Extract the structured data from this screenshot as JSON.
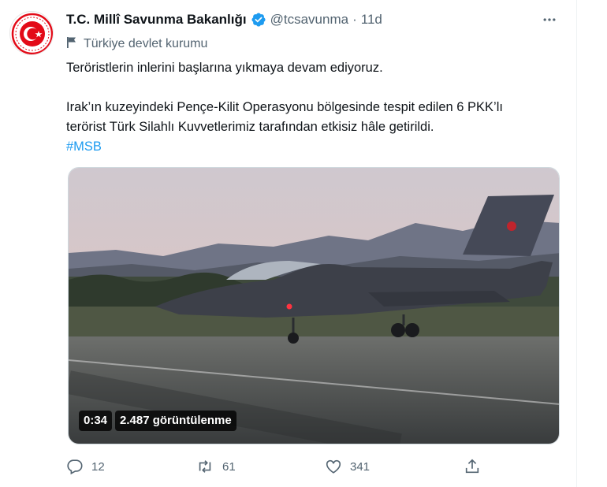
{
  "tweet": {
    "author": {
      "name": "T.C. Millî Savunma Bakanlığı",
      "handle": "@tcsavunma",
      "separator": "·",
      "time": "11d"
    },
    "label": "Türkiye devlet kurumu",
    "text_lines": [
      "Teröristlerin inlerini başlarına yıkmaya devam ediyoruz.",
      "Irak’ın kuzeyindeki Pençe-Kilit Operasyonu bölgesinde tespit edilen 6 PKK’lı",
      "terörist Türk Silahlı Kuvvetlerimiz tarafından etkisiz hâle getirildi."
    ],
    "hashtag": "#MSB",
    "video": {
      "duration": "0:34",
      "views": "2.487 görüntülenme"
    },
    "actions": {
      "replies": "12",
      "retweets": "61",
      "likes": "341"
    }
  },
  "colors": {
    "accent": "#1d9bf0",
    "secondary_text": "#536471",
    "primary_text": "#0f1419",
    "emblem_red": "#e30a17"
  },
  "icons": {
    "more": "more-icon",
    "verified": "verified-badge-icon",
    "label": "flag-icon",
    "reply": "reply-icon",
    "retweet": "retweet-icon",
    "like": "heart-icon",
    "share": "share-icon"
  }
}
